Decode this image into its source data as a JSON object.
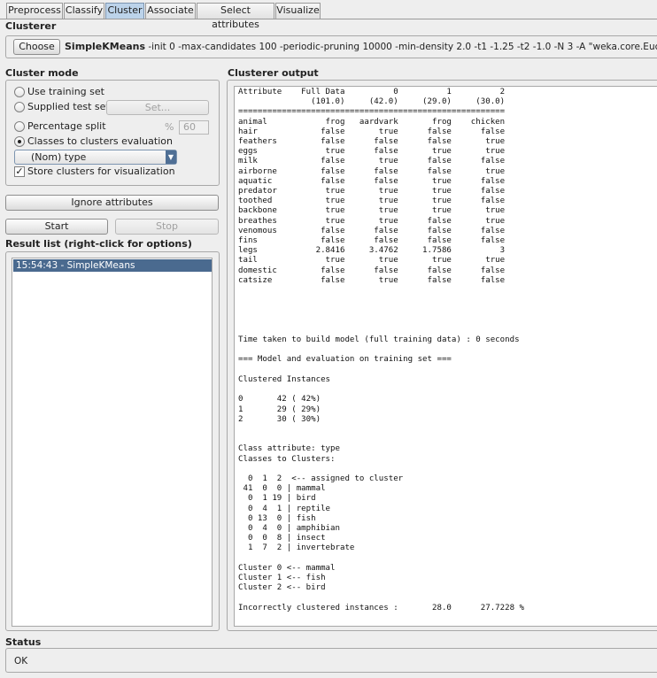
{
  "tabs": [
    {
      "label": "Preprocess"
    },
    {
      "label": "Classify"
    },
    {
      "label": "Cluster"
    },
    {
      "label": "Associate"
    },
    {
      "label": "Select attributes"
    },
    {
      "label": "Visualize"
    }
  ],
  "active_tab": "Cluster",
  "clusterer": {
    "section_title": "Clusterer",
    "choose_label": "Choose",
    "algorithm": "SimpleKMeans",
    "options": "-init 0 -max-candidates 100 -periodic-pruning 10000 -min-density 2.0 -t1 -1.25 -t2 -1.0 -N 3 -A \"weka.core.EuclideanDistance -R"
  },
  "cluster_mode": {
    "title": "Cluster mode",
    "use_training_set": "Use training set",
    "supplied_test_set": "Supplied test set",
    "set_button": "Set...",
    "percentage_split": "Percentage split",
    "percent_sign": "%",
    "percentage_value": "60",
    "classes_to_clusters": "Classes to clusters evaluation",
    "class_attribute": "(Nom) type",
    "store_clusters": "Store clusters for visualization",
    "selected": "classes_to_clusters",
    "store_checked": true
  },
  "buttons": {
    "ignore_attributes": "Ignore attributes",
    "start": "Start",
    "stop": "Stop"
  },
  "result_list": {
    "title": "Result list (right-click for options)",
    "items": [
      "15:54:43 - SimpleKMeans"
    ]
  },
  "output": {
    "title": "Clusterer output",
    "text": "Attribute    Full Data          0          1          2\n               (101.0)     (42.0)     (29.0)     (30.0)\n=======================================================\nanimal            frog   aardvark       frog    chicken\nhair             false       true      false      false\nfeathers         false      false      false       true\neggs              true      false       true       true\nmilk             false       true      false      false\nairborne         false      false      false       true\naquatic          false      false       true      false\npredator          true       true       true      false\ntoothed           true       true       true      false\nbackbone          true       true       true       true\nbreathes          true       true      false       true\nvenomous         false      false      false      false\nfins             false      false      false      false\nlegs            2.8416     3.4762     1.7586          3\ntail              true       true       true       true\ndomestic         false      false      false      false\ncatsize          false       true      false      false\n\n\n\n\n\nTime taken to build model (full training data) : 0 seconds\n\n=== Model and evaluation on training set ===\n\nClustered Instances\n\n0       42 ( 42%)\n1       29 ( 29%)\n2       30 ( 30%)\n\n\nClass attribute: type\nClasses to Clusters:\n\n  0  1  2  <-- assigned to cluster\n 41  0  0 | mammal\n  0  1 19 | bird\n  0  4  1 | reptile\n  0 13  0 | fish\n  0  4  0 | amphibian\n  0  0  8 | insect\n  1  7  2 | invertebrate\n\nCluster 0 <-- mammal\nCluster 1 <-- fish\nCluster 2 <-- bird\n\nIncorrectly clustered instances :       28.0      27.7228 %"
  },
  "status": {
    "title": "Status",
    "message": "OK"
  },
  "colors": {
    "active_tab": "#bcd3ea",
    "selection": "#4a6a8f"
  }
}
